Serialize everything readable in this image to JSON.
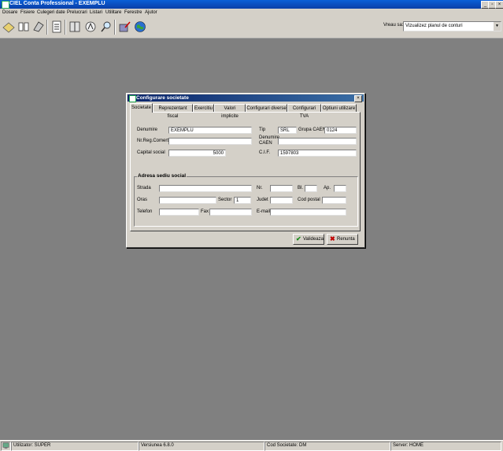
{
  "window": {
    "title": "CIEL Conta Professional - EXEMPLU"
  },
  "menu": [
    "Dosare",
    "Fisiere",
    "Culegeri date",
    "Prelucrari",
    "Listari",
    "Utilitare",
    "Ferestre",
    "Ajutor"
  ],
  "toolbar": {
    "view_label": "Vreau sa:",
    "view_value": "Vizualizez planul de conturi"
  },
  "dialog": {
    "title": "Configurare societate",
    "tabs": [
      "Societate",
      "Reprezentant fiscal",
      "Exercitiu",
      "Valori implicite",
      "Configurari diverse",
      "Configurari TVA",
      "Optiuni utilizare"
    ],
    "fields": {
      "denumire_label": "Denumire",
      "denumire_value": "EXEMPLU",
      "nrreg_label": "Nr.Reg.Comert",
      "nrreg_value": "",
      "capital_label": "Capital social",
      "capital_value": "5000",
      "tip_label": "Tip",
      "tip_value": "SRL",
      "caen_label": "Grupa CAEN",
      "caen_value": "0124",
      "dencaen_label1": "Denumire",
      "dencaen_label2": "CAEN",
      "dencaen_value": "",
      "cif_label": "C.I.F.",
      "cif_value": "1597803"
    },
    "address": {
      "group_title": "Adresa sediu social",
      "strada_label": "Strada",
      "strada_value": "",
      "nr_label": "Nr.",
      "nr_value": "",
      "bl_label": "Bl.",
      "bl_value": "",
      "ap_label": "Ap.",
      "ap_value": "",
      "oras_label": "Oras",
      "oras_value": "",
      "sector_label": "Sector",
      "sector_value": "1",
      "judet_label": "Judet",
      "judet_value": "",
      "codpostal_label": "Cod postal",
      "codpostal_value": "",
      "telefon_label": "Telefon",
      "telefon_value": "",
      "fax_label": "Fax",
      "fax_value": "",
      "email_label": "E-mail",
      "email_value": ""
    },
    "buttons": {
      "ok": "Valideaza",
      "cancel": "Renunta"
    }
  },
  "status": {
    "user": "Utilizator: SUPER",
    "version": "Versiunea  6.8.0",
    "company": "Cod Societate: DM",
    "server": "Server: HOME"
  }
}
